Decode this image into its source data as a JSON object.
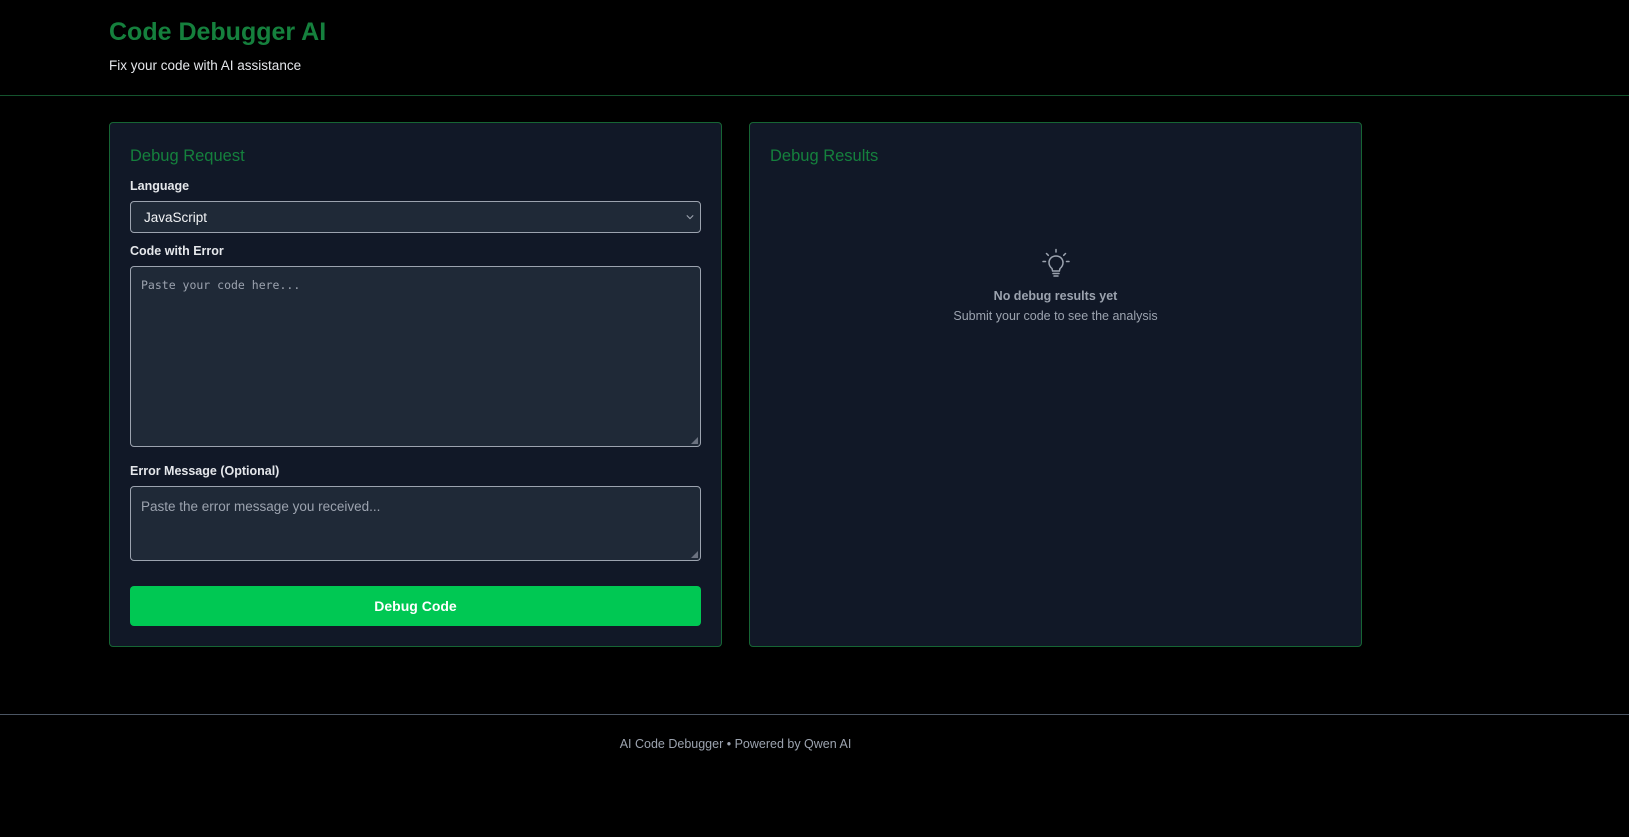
{
  "header": {
    "title": "Code Debugger AI",
    "subtitle": "Fix your code with AI assistance"
  },
  "request_panel": {
    "title": "Debug Request",
    "language_label": "Language",
    "language_value": "JavaScript",
    "code_label": "Code with Error",
    "code_placeholder": "Paste your code here...",
    "error_label": "Error Message (Optional)",
    "error_placeholder": "Paste the error message you received...",
    "submit_label": "Debug Code"
  },
  "results_panel": {
    "title": "Debug Results",
    "empty_icon": "lightbulb-icon",
    "empty_title": "No debug results yet",
    "empty_subtitle": "Submit your code to see the analysis"
  },
  "footer": {
    "text": "AI Code Debugger • Powered by Qwen AI"
  },
  "colors": {
    "background": "#000000",
    "accent_green": "#15803d",
    "button_green": "#00c853",
    "panel_bg": "#111827",
    "panel_border": "#166534",
    "input_bg": "#1f2937",
    "muted_text": "#9ca3af"
  }
}
